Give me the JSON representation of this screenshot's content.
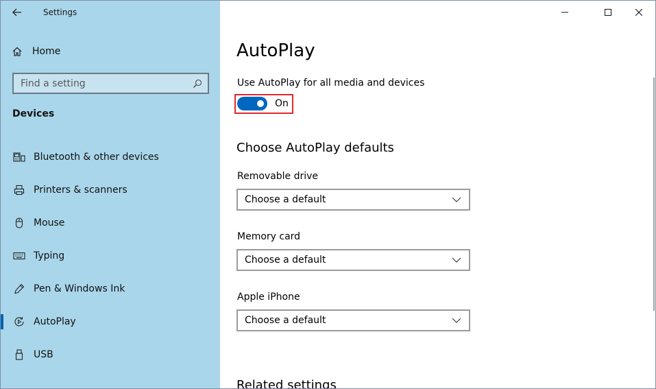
{
  "window": {
    "title": "Settings"
  },
  "sidebar": {
    "home_label": "Home",
    "search": {
      "placeholder": "Find a setting",
      "value": ""
    },
    "section_title": "Devices",
    "items": [
      {
        "label": "Bluetooth & other devices",
        "icon": "bluetooth-devices-icon"
      },
      {
        "label": "Printers & scanners",
        "icon": "printer-icon"
      },
      {
        "label": "Mouse",
        "icon": "mouse-icon"
      },
      {
        "label": "Typing",
        "icon": "keyboard-icon"
      },
      {
        "label": "Pen & Windows Ink",
        "icon": "pen-icon"
      },
      {
        "label": "AutoPlay",
        "icon": "autoplay-icon",
        "active": true
      },
      {
        "label": "USB",
        "icon": "usb-icon"
      }
    ]
  },
  "main": {
    "title": "AutoPlay",
    "toggle": {
      "label": "Use AutoPlay for all media and devices",
      "state": "On",
      "on": true
    },
    "defaults_heading": "Choose AutoPlay defaults",
    "fields": [
      {
        "label": "Removable drive",
        "value": "Choose a default"
      },
      {
        "label": "Memory card",
        "value": "Choose a default"
      },
      {
        "label": "Apple iPhone",
        "value": "Choose a default"
      }
    ],
    "related_heading": "Related settings"
  },
  "colors": {
    "sidebar_bg": "#a9d6ea",
    "accent": "#0067c0",
    "highlight_border": "#e0282f"
  }
}
